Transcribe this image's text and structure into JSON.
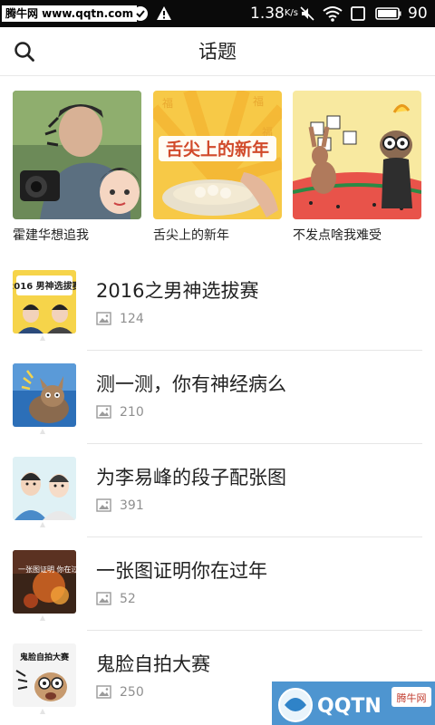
{
  "status_bar": {
    "watermark": "腾牛网 www.qqtn.com",
    "speed": "1.38",
    "speed_unit": "K/s",
    "battery": "90"
  },
  "header": {
    "title": "话题",
    "icons": {
      "search": "search-icon"
    }
  },
  "featured": [
    {
      "label": "霍建华想追我"
    },
    {
      "label": "舌尖上的新年",
      "image_text": "舌尖上的新年"
    },
    {
      "label": "不发点啥我难受"
    }
  ],
  "topics": [
    {
      "title": "2016之男神选拔赛",
      "count": "124",
      "thumb_text": "2016 男神选拔赛"
    },
    {
      "title": "测一测，你有神经病么",
      "count": "210"
    },
    {
      "title": "为李易峰的段子配张图",
      "count": "391"
    },
    {
      "title": "一张图证明你在过年",
      "count": "52",
      "thumb_text": "一张图证明 你在过年"
    },
    {
      "title": "鬼脸自拍大赛",
      "count": "250",
      "thumb_text": "鬼脸自拍大赛"
    }
  ],
  "watermark_bottom": {
    "logo": "QQTN",
    "badge": "腾牛网"
  },
  "colors": {
    "status_bar": "#0a0a0a",
    "title_text": "#222222",
    "meta_text": "#8f8f8f",
    "divider": "#e6e6e6"
  }
}
